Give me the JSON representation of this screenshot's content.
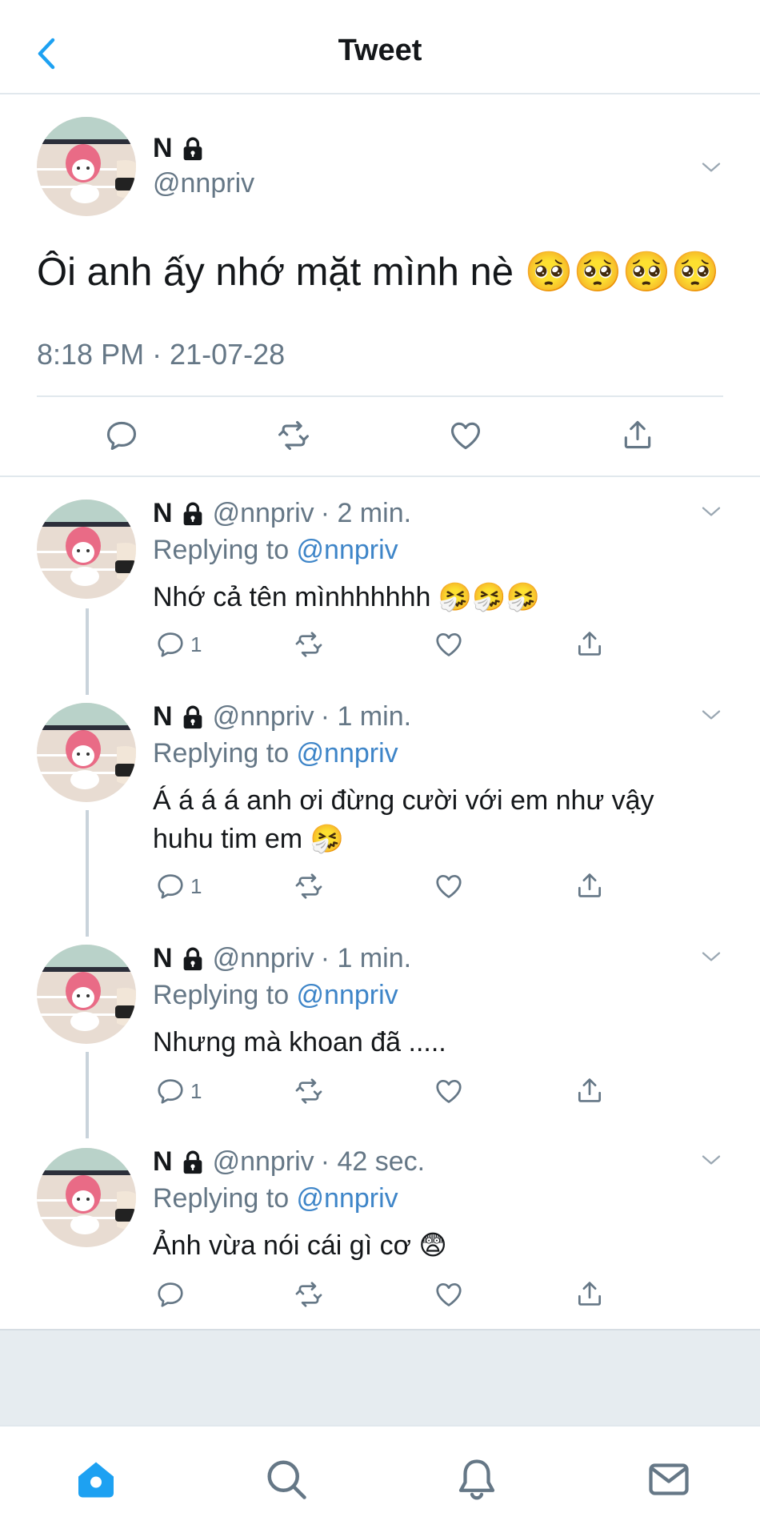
{
  "header": {
    "title": "Tweet"
  },
  "main_tweet": {
    "name": "N",
    "handle": "@nnpriv",
    "text": "Ôi anh ấy nhớ mặt mình nè 🥺🥺🥺🥺",
    "timestamp": "8:18 PM · 21-07-28"
  },
  "replies": [
    {
      "name": "N",
      "handle": "@nnpriv",
      "time": "· 2 min.",
      "replying_label": "Replying to ",
      "replying_to": "@nnpriv",
      "text": "Nhớ cả tên mìnhhhhhh 🤧🤧🤧",
      "reply_count": "1"
    },
    {
      "name": "N",
      "handle": "@nnpriv",
      "time": "· 1 min.",
      "replying_label": "Replying to ",
      "replying_to": "@nnpriv",
      "text": "Á á á á anh ơi đừng cười với em như vậy huhu tim em 🤧",
      "reply_count": "1"
    },
    {
      "name": "N",
      "handle": "@nnpriv",
      "time": "· 1 min.",
      "replying_label": "Replying to ",
      "replying_to": "@nnpriv",
      "text": "Nhưng mà khoan đã .....",
      "reply_count": "1"
    },
    {
      "name": "N",
      "handle": "@nnpriv",
      "time": "· 42 sec.",
      "replying_label": "Replying to ",
      "replying_to": "@nnpriv",
      "text": "Ảnh vừa nói cái gì cơ 😨",
      "reply_count": ""
    }
  ],
  "icons": {
    "back": "chevron-left-icon",
    "lock": "lock-icon",
    "more": "chevron-down-icon",
    "reply": "reply-icon",
    "retweet": "retweet-icon",
    "like": "heart-icon",
    "share": "share-icon",
    "tabs": [
      "home-icon",
      "search-icon",
      "notifications-icon",
      "messages-icon"
    ]
  },
  "colors": {
    "accent": "#1da1f2",
    "link": "#3e85c8",
    "secondary_text": "#657786"
  }
}
